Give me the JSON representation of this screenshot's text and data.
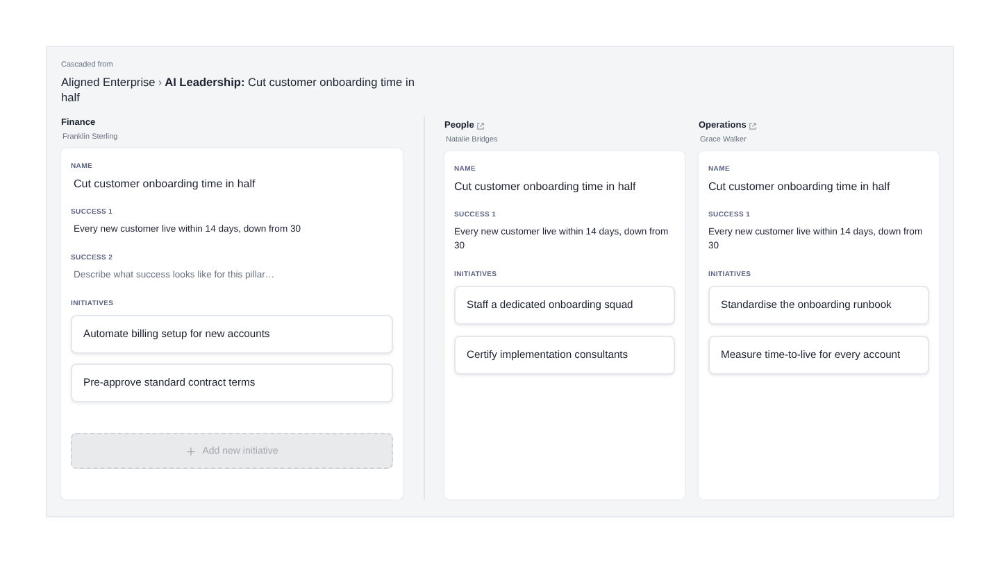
{
  "header": {
    "caption": "Cascaded from",
    "breadcrumb": "Aligned Enterprise",
    "separator": "›",
    "title": "**AI Leadership:** Cut customer onboarding time in half"
  },
  "pillars": [
    {
      "name": "Finance",
      "owner": "Franklin Sterling",
      "editable": true,
      "external_link": false,
      "fields": [
        {
          "label": "NAME",
          "value": "Cut customer onboarding time in half",
          "kind": "name"
        },
        {
          "label": "SUCCESS 1",
          "value": "Every new customer live within 14 days, down from 30",
          "kind": "text"
        },
        {
          "label": "SUCCESS 2",
          "placeholder": "Describe what success looks like for this pillar…",
          "kind": "text"
        }
      ],
      "initiatives_label": "INITIATIVES",
      "initiatives": [
        "Automate billing setup for new accounts",
        "Pre-approve standard contract terms"
      ],
      "add_button": {
        "label": "Add new initiative",
        "disabled": true
      }
    },
    {
      "name": "People",
      "owner": "Natalie Bridges",
      "editable": false,
      "external_link": true,
      "fields": [
        {
          "label": "NAME",
          "value": "Cut customer onboarding time in half",
          "kind": "name"
        },
        {
          "label": "SUCCESS 1",
          "value": "Every new customer live within 14 days, down from 30",
          "kind": "text"
        }
      ],
      "initiatives_label": "INITIATIVES",
      "initiatives": [
        "Staff a dedicated onboarding squad",
        "Certify implementation consultants"
      ]
    },
    {
      "name": "Operations",
      "owner": "Grace Walker",
      "editable": false,
      "external_link": true,
      "fields": [
        {
          "label": "NAME",
          "value": "Cut customer onboarding time in half",
          "kind": "name"
        },
        {
          "label": "SUCCESS 1",
          "value": "Every new customer live within 14 days, down from 30",
          "kind": "text"
        }
      ],
      "initiatives_label": "INITIATIVES",
      "initiatives": [
        "Standardise the onboarding runbook",
        "Measure time-to-live for every account"
      ]
    }
  ]
}
